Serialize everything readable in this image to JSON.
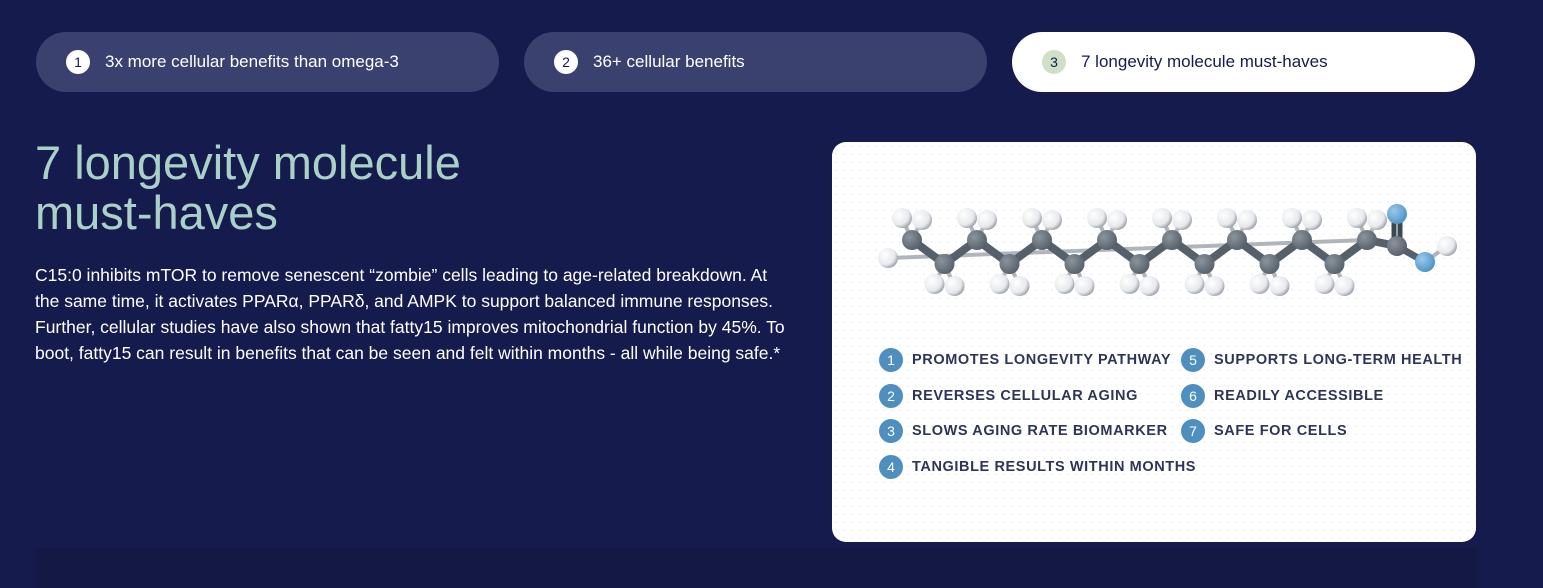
{
  "tabs": [
    {
      "num": "1",
      "label": "3x more cellular benefits than omega-3",
      "active": false
    },
    {
      "num": "2",
      "label": "36+ cellular benefits",
      "active": false
    },
    {
      "num": "3",
      "label": "7 longevity molecule must-haves",
      "active": true
    }
  ],
  "main": {
    "title_line1": "7 longevity molecule",
    "title_line2": "must-haves",
    "description": "C15:0 inhibits mTOR to remove senescent “zombie” cells leading to age-related breakdown. At the same time, it activates PPARα, PPARδ, and AMPK to support balanced immune responses. Further, cellular studies have also shown that fatty15 improves mitochondrial function by 45%. To boot, fatty15 can result in benefits that can be seen and felt within months - all while being safe.*"
  },
  "card": {
    "features": [
      {
        "num": "1",
        "label": "PROMOTES LONGEVITY PATHWAY"
      },
      {
        "num": "2",
        "label": "REVERSES CELLULAR AGING"
      },
      {
        "num": "3",
        "label": "SLOWS AGING RATE BIOMARKER"
      },
      {
        "num": "4",
        "label": "TANGIBLE RESULTS WITHIN MONTHS"
      },
      {
        "num": "5",
        "label": "SUPPORTS LONG-TERM HEALTH"
      },
      {
        "num": "6",
        "label": "READILY ACCESSIBLE"
      },
      {
        "num": "7",
        "label": "SAFE FOR CELLS"
      }
    ]
  },
  "colors": {
    "background": "#161b4e",
    "tab_inactive": "#3a416f",
    "title_accent": "#a9d1c7",
    "feature_badge": "#4f8fbf",
    "molecule_carbon": "#55606a",
    "molecule_oxygen": "#4a93c8"
  }
}
